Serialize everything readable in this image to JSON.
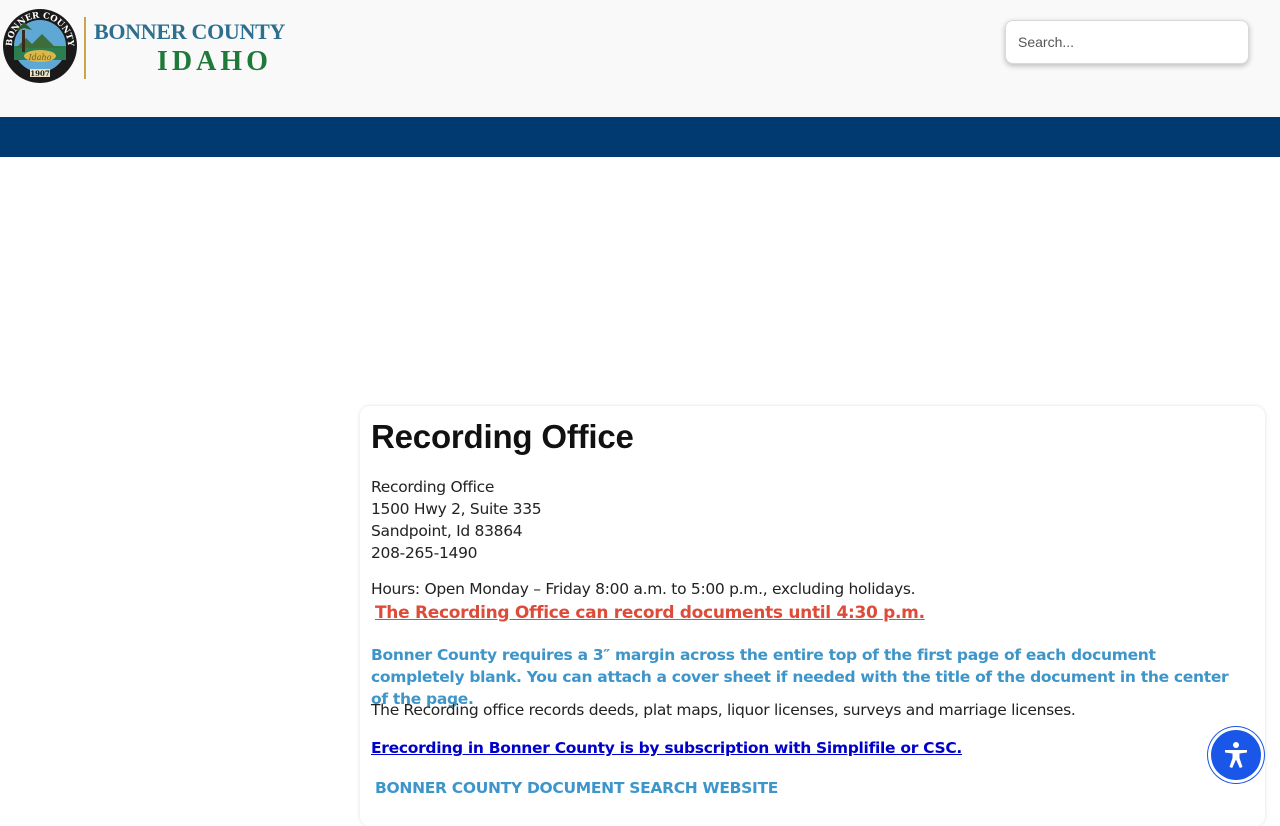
{
  "header": {
    "logo": {
      "seal_text": "BONNER COUNTY",
      "seal_year": "1907",
      "line1": "BONNER COUNTY",
      "line2": "IDAHO"
    },
    "search": {
      "placeholder": "Search..."
    }
  },
  "colors": {
    "header_bg": "#f9f9f9",
    "navbar": "#003a70",
    "alert_red": "#dd4b39",
    "note_blue": "#3d95c9",
    "link_blue": "#0000cc",
    "a11y_button": "#1a56e8"
  },
  "main": {
    "title": "Recording Office",
    "address": {
      "name": "Recording Office",
      "street": "1500 Hwy 2, Suite 335",
      "city": "Sandpoint, Id 83864",
      "phone": "208-265-1490"
    },
    "hours": "Hours:  Open Monday – Friday 8:00 a.m. to 5:00 p.m., excluding holidays.",
    "record_deadline": "The Recording Office can record documents until 4:30 p.m. ",
    "margin_note": "Bonner County requires a 3″ margin across the entire top of the first page of each document completely blank. You can attach a cover sheet if needed with the title of the document in the center of the page.",
    "records_text": "The Recording office records deeds, plat maps, liquor licenses, surveys and marriage licenses.",
    "erecording_link": "Erecording in Bonner County is by subscription with Simplifile or CSC. ",
    "doc_search_link": "BONNER COUNTY DOCUMENT SEARCH WEBSITE"
  },
  "accessibility": {
    "icon": "accessibility-person-icon"
  }
}
